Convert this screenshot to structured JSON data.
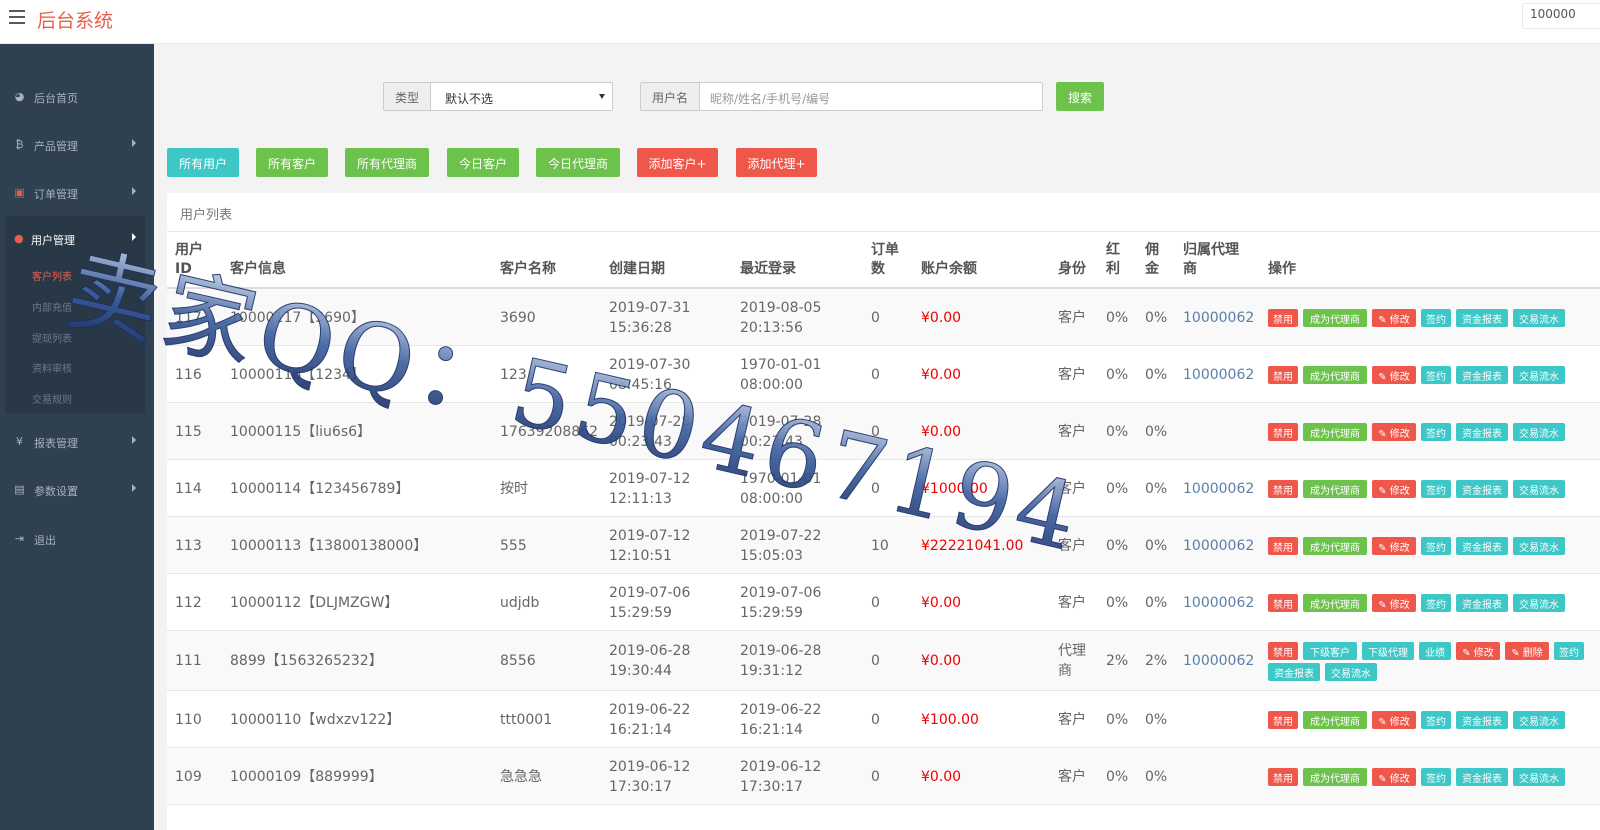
{
  "header": {
    "brand": "后台系统",
    "user": "100000"
  },
  "sidebar": {
    "items": [
      {
        "label": "后台首页",
        "icon": "dashboard-icon",
        "glyph": "◕"
      },
      {
        "label": "产品管理",
        "icon": "bitcoin-icon",
        "glyph": "₿"
      },
      {
        "label": "订单管理",
        "icon": "copy-icon",
        "glyph": "▣"
      },
      {
        "label": "用户管理",
        "icon": "user-icon",
        "glyph": "●"
      },
      {
        "label": "报表管理",
        "icon": "yen-icon",
        "glyph": "¥"
      },
      {
        "label": "参数设置",
        "icon": "files-icon",
        "glyph": "▤"
      },
      {
        "label": "退出",
        "icon": "sign-out-icon",
        "glyph": "⇥"
      }
    ],
    "sub_items": [
      "客户列表",
      "内部充值",
      "提现列表",
      "资料审核",
      "交易规则"
    ]
  },
  "search": {
    "type_label": "类型",
    "type_value": "默认不选",
    "name_label": "用户名",
    "name_placeholder": "昵称/姓名/手机号/编号",
    "search_button": "搜索"
  },
  "filters": [
    "所有用户",
    "所有客户",
    "所有代理商",
    "今日客户",
    "今日代理商",
    "添加客户+",
    "添加代理+"
  ],
  "table": {
    "panel_title": "用户列表",
    "headers": {
      "id": [
        "用户",
        "ID"
      ],
      "info": "客户信息",
      "name": "客户名称",
      "created": "创建日期",
      "login": "最近登录",
      "orders": [
        "订单",
        "数"
      ],
      "balance": "账户余额",
      "role": "身份",
      "bonus": [
        "红",
        "利"
      ],
      "commission": [
        "佣",
        "金"
      ],
      "agent": [
        "归属代理",
        "商"
      ],
      "ops": "操作"
    },
    "rows": [
      {
        "id": "117",
        "info": "10000117【3690】",
        "name": "3690",
        "created_date": "2019-07-31",
        "created_time": "15:36:28",
        "login_date": "2019-08-05",
        "login_time": "20:13:56",
        "orders": "0",
        "balance": "¥0.00",
        "role": "客户",
        "bonus": "0%",
        "commission": "0%",
        "agent": "10000062"
      },
      {
        "id": "116",
        "info": "10000116【1234】",
        "name": "123",
        "created_date": "2019-07-30",
        "created_time": "08:45:16",
        "login_date": "1970-01-01",
        "login_time": "08:00:00",
        "orders": "0",
        "balance": "¥0.00",
        "role": "客户",
        "bonus": "0%",
        "commission": "0%",
        "agent": "10000062"
      },
      {
        "id": "115",
        "info": "10000115【liu6s6】",
        "name": "17639208862",
        "created_date": "2019-07-28",
        "created_time": "00:23:43",
        "login_date": "2019-07-28",
        "login_time": "00:23:43",
        "orders": "0",
        "balance": "¥0.00",
        "role": "客户",
        "bonus": "0%",
        "commission": "0%",
        "agent": ""
      },
      {
        "id": "114",
        "info": "10000114【123456789】",
        "name": "按时",
        "created_date": "2019-07-12",
        "created_time": "12:11:13",
        "login_date": "1970-01-01",
        "login_time": "08:00:00",
        "orders": "0",
        "balance": "¥1000.00",
        "role": "客户",
        "bonus": "0%",
        "commission": "0%",
        "agent": "10000062"
      },
      {
        "id": "113",
        "info": "10000113【13800138000】",
        "name": "555",
        "created_date": "2019-07-12",
        "created_time": "12:10:51",
        "login_date": "2019-07-22",
        "login_time": "15:05:03",
        "orders": "10",
        "balance": "¥22221041.00",
        "role": "客户",
        "bonus": "0%",
        "commission": "0%",
        "agent": "10000062"
      },
      {
        "id": "112",
        "info": "10000112【DLJMZGW】",
        "name": "udjdb",
        "created_date": "2019-07-06",
        "created_time": "15:29:59",
        "login_date": "2019-07-06",
        "login_time": "15:29:59",
        "orders": "0",
        "balance": "¥0.00",
        "role": "客户",
        "bonus": "0%",
        "commission": "0%",
        "agent": "10000062"
      },
      {
        "id": "111",
        "info": "8899【1563265232】",
        "name": "8556",
        "created_date": "2019-06-28",
        "created_time": "19:30:44",
        "login_date": "2019-06-28",
        "login_time": "19:31:12",
        "orders": "0",
        "balance": "¥0.00",
        "role": "代理商",
        "bonus": "2%",
        "commission": "2%",
        "agent": "10000062"
      },
      {
        "id": "110",
        "info": "10000110【wdxzv122】",
        "name": "ttt0001",
        "created_date": "2019-06-22",
        "created_time": "16:21:14",
        "login_date": "2019-06-22",
        "login_time": "16:21:14",
        "orders": "0",
        "balance": "¥100.00",
        "role": "客户",
        "bonus": "0%",
        "commission": "0%",
        "agent": ""
      },
      {
        "id": "109",
        "info": "10000109【889999】",
        "name": "急急急",
        "created_date": "2019-06-12",
        "created_time": "17:30:17",
        "login_date": "2019-06-12",
        "login_time": "17:30:17",
        "orders": "0",
        "balance": "¥0.00",
        "role": "客户",
        "bonus": "0%",
        "commission": "0%",
        "agent": ""
      }
    ],
    "customer_ops": [
      "禁用",
      "成为代理商",
      "✎ 修改",
      "签约",
      "资金报表",
      "交易流水"
    ],
    "agent_ops": [
      "禁用",
      "下级客户",
      "下级代理",
      "业绩",
      "✎ 修改",
      "✎ 删除",
      "签约",
      "资金报表",
      "交易流水"
    ]
  },
  "watermark": "卖家QQ：550467194",
  "colors": {
    "sidebar": "#2f4050",
    "accent": "#e8604c",
    "teal": "#3ec7c7",
    "green": "#6dc24b",
    "red": "#f0574b",
    "money": "#ee0000"
  }
}
